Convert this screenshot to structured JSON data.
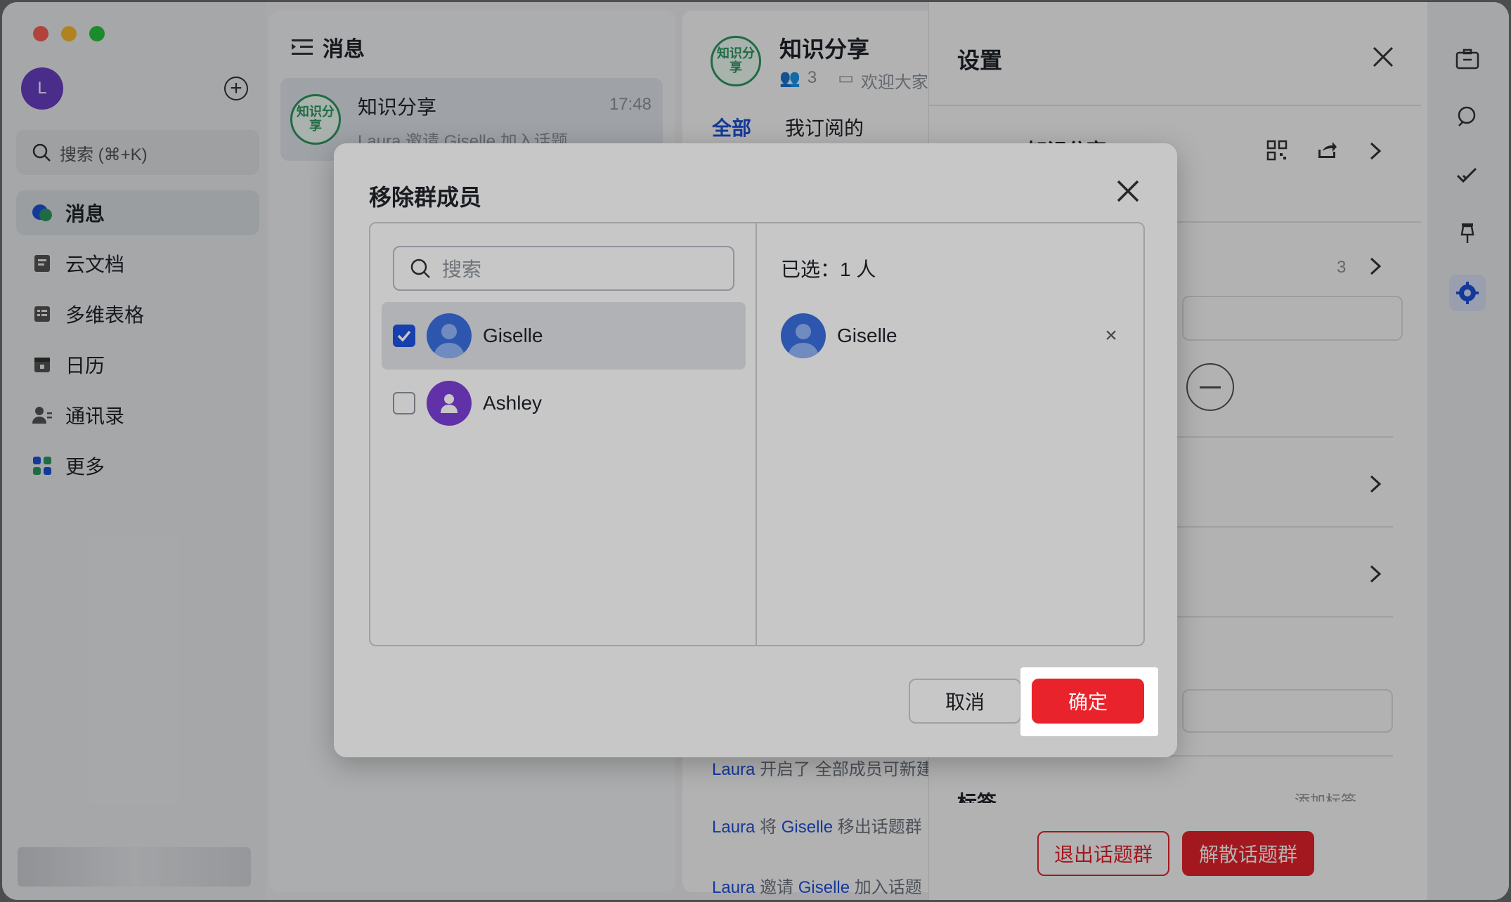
{
  "sidebar": {
    "user_initial": "L",
    "search_placeholder": "搜索 (⌘+K)",
    "items": [
      {
        "label": "消息",
        "icon": "chat-bubble-icon"
      },
      {
        "label": "云文档",
        "icon": "document-icon"
      },
      {
        "label": "多维表格",
        "icon": "table-icon"
      },
      {
        "label": "日历",
        "icon": "calendar-icon"
      },
      {
        "label": "通讯录",
        "icon": "contacts-icon"
      },
      {
        "label": "更多",
        "icon": "grid-more-icon"
      }
    ]
  },
  "conversation_list": {
    "title": "消息",
    "item": {
      "avatar_text": "知识分享",
      "name": "知识分享",
      "time": "17:48",
      "preview": "Laura 邀请 Giselle 加入话题..."
    }
  },
  "chat": {
    "group_avatar": "知识分享",
    "group_name": "知识分享",
    "member_count": "3",
    "announcement": "欢迎大家",
    "tabs": [
      "全部",
      "我订阅的"
    ],
    "messages": [
      {
        "actor": "Laura",
        "text": "开启了 全部成员可新建"
      },
      {
        "actor": "Laura",
        "verb": "将",
        "target": "Giselle",
        "text": "移出话题群"
      },
      {
        "actor": "Laura",
        "verb": "邀请",
        "target": "Giselle",
        "text": "加入话题"
      }
    ]
  },
  "settings": {
    "title": "设置",
    "group_name": "知识分享",
    "members_count": "3",
    "tag_label": "标签",
    "add_tag": "添加标签",
    "leave_button": "退出话题群",
    "dissolve_button": "解散话题群"
  },
  "modal": {
    "title": "移除群成员",
    "search_placeholder": "搜索",
    "members": [
      {
        "name": "Giselle",
        "checked": true
      },
      {
        "name": "Ashley",
        "checked": false
      }
    ],
    "selected_label": "已选：1 人",
    "selected": [
      {
        "name": "Giselle"
      }
    ],
    "cancel_label": "取消",
    "confirm_label": "确定"
  },
  "colors": {
    "accent_blue": "#1d52de",
    "confirm_red": "#e8232b",
    "group_green": "#2f9a62",
    "user_purple": "#6b3fc8"
  }
}
